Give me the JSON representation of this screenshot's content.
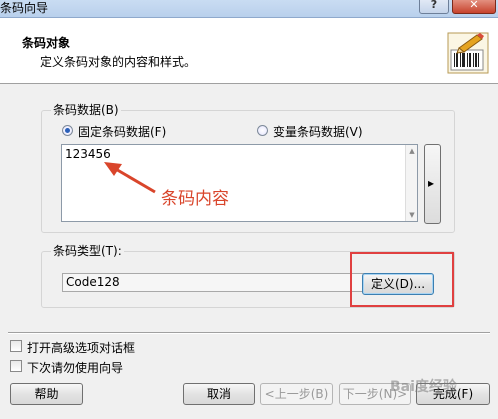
{
  "window": {
    "title": "条码向导"
  },
  "header": {
    "title": "条码对象",
    "subtitle": "定义条码对象的内容和样式。",
    "icon": "barcode-pencil-icon"
  },
  "data_group": {
    "label": "条码数据(B)",
    "radio_fixed": "固定条码数据(F)",
    "radio_variable": "变量条码数据(V)",
    "selected": "fixed",
    "content": "123456",
    "side_button": "▸"
  },
  "annotation": {
    "text": "条码内容",
    "color": "#d9452b"
  },
  "type_group": {
    "label": "条码类型(T):",
    "value": "Code128",
    "define_button": "定义(D)..."
  },
  "options": {
    "advanced_dialog": "打开高级选项对话框",
    "dont_use_wizard": "下次请勿使用向导"
  },
  "footer": {
    "help": "帮助",
    "cancel": "取消",
    "back": "<上一步(B)",
    "next": "下一步(N)>",
    "finish": "完成(F)"
  },
  "watermark": "Bai度经验"
}
